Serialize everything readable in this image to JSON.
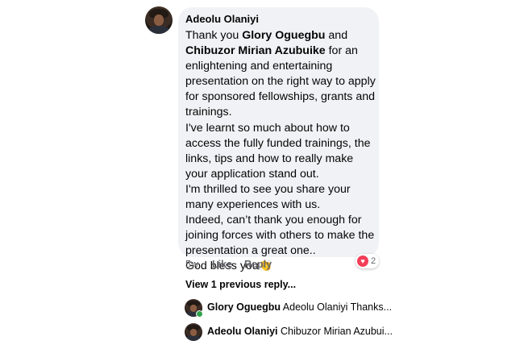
{
  "comment": {
    "author": "Adeolu Olaniyi",
    "text_parts": {
      "p1": "Thank you ",
      "mention1": "Glory Oguegbu",
      "p2": " and ",
      "mention2": "Chibuzor Mirian Azubuike",
      "p3": " for an enlightening and entertaining presentation on the right way to apply for sponsored fellowships, grants and trainings.",
      "p4": "I've learnt so much about how to access the fully funded trainings, the links, tips and how to really make your application stand out.",
      "p5": "I'm thrilled to see you share your many experiences with us.",
      "p6": "Indeed, can’t thank you enough for joining forces with others to make the presentation a great one..",
      "p7": "God bless you",
      "emoji": "👏"
    },
    "time": "5w",
    "like_label": "Like",
    "reply_label": "Reply",
    "reaction_icon": "heart-icon",
    "reaction_count": "2",
    "reaction_color": "#f33e58"
  },
  "replies": {
    "view_previous": "View 1 previous reply...",
    "items": [
      {
        "name": "Glory Oguegbu",
        "preview": "Adeolu Olaniyi Thanks..."
      },
      {
        "name": "Adeolu Olaniyi",
        "preview": "Chibuzor Mirian Azubui..."
      }
    ]
  }
}
